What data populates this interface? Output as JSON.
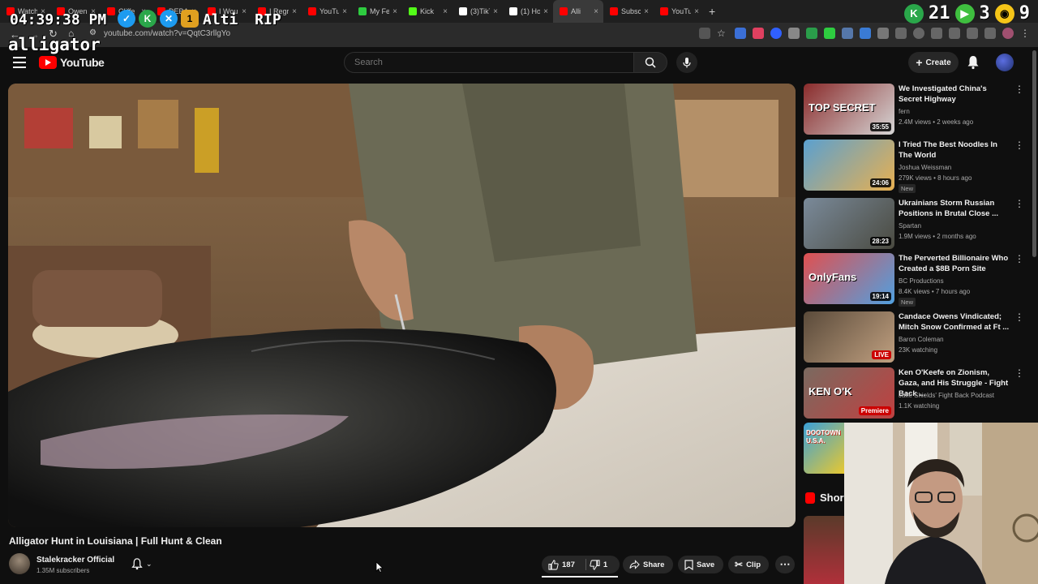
{
  "browser": {
    "tabs": [
      {
        "label": "Watch",
        "color": "#ff0000"
      },
      {
        "label": "Owen",
        "color": "#ff0000"
      },
      {
        "label": "Cliffe",
        "color": "#ff0000"
      },
      {
        "label": "DEBATI",
        "color": "#ff0000"
      },
      {
        "label": "I Wou",
        "color": "#ff0000"
      },
      {
        "label": "I Regr",
        "color": "#ff0000"
      },
      {
        "label": "YouTul",
        "color": "#ff0000"
      },
      {
        "label": "My Fee",
        "color": "#2ecc40"
      },
      {
        "label": "Kick",
        "color": "#53fc18"
      },
      {
        "label": "(3)TikT",
        "color": "#ffffff"
      },
      {
        "label": "(1) Hon",
        "color": "#ffffff"
      },
      {
        "label": "Alli",
        "color": "#ff0000"
      },
      {
        "label": "Subscr",
        "color": "#ff0000"
      },
      {
        "label": "YouTul",
        "color": "#ff0000"
      }
    ],
    "url": "youtube.com/watch?v=QqtC3rllgYo",
    "new_tab": "+"
  },
  "overlay": {
    "clock": "04:39:38 PM",
    "alti": "Alti RIP",
    "caption": "alligator",
    "top_right_1": "2",
    "top_right_2": "1",
    "top_right_3": "3",
    "top_right_4": "9"
  },
  "youtube": {
    "logo_text": "YouTube",
    "search_placeholder": "Search",
    "create_label": "Create"
  },
  "video": {
    "title": "Alligator Hunt in Louisiana | Full Hunt & Clean",
    "channel": "Stalekracker Official",
    "subscribers": "1.35M subscribers",
    "likes": "187",
    "dislikes": "1",
    "share_label": "Share",
    "save_label": "Save",
    "clip_label": "Clip"
  },
  "recommendations": [
    {
      "title": "We Investigated China's Secret Highway",
      "channel": "fern",
      "meta": "2.4M views • 2 weeks ago",
      "duration": "35:55",
      "badge": "",
      "thumb_text": "TOP SECRET"
    },
    {
      "title": "I Tried The Best Noodles In The World",
      "channel": "Joshua Weissman",
      "meta": "279K views • 8 hours ago",
      "duration": "24:06",
      "badge": "New",
      "thumb_text": ""
    },
    {
      "title": "Ukrainians Storm Russian Positions in Brutal Close ...",
      "channel": "Spartan",
      "meta": "1.9M views • 2 months ago",
      "duration": "28:23",
      "badge": "",
      "thumb_text": ""
    },
    {
      "title": "The Perverted Billionaire Who Created a $8B Porn Site",
      "channel": "BC Productions",
      "meta": "8.4K views • 7 hours ago",
      "duration": "19:14",
      "badge": "New",
      "thumb_text": "OnlyFans"
    },
    {
      "title": "Candace Owens Vindicated; Mitch Snow Confirmed at Ft ...",
      "channel": "Baron Coleman",
      "meta": "23K watching",
      "duration": "LIVE",
      "badge": "",
      "thumb_text": ""
    },
    {
      "title": "Ken O'Keefe on Zionism, Gaza, and His Struggle - Fight Back ...",
      "channel": "Jake Shields' Fight Back Podcast",
      "meta": "1.1K watching",
      "duration": "Premiere",
      "badge": "",
      "thumb_text": "KEN O'K"
    }
  ],
  "sidebar_extra": {
    "shorts_label": "Shor",
    "dootown_text": "DOOTOWN U.S.A."
  },
  "colors": {
    "youtube_red": "#ff0000",
    "background": "#0f0f0f",
    "chip": "#272727"
  }
}
